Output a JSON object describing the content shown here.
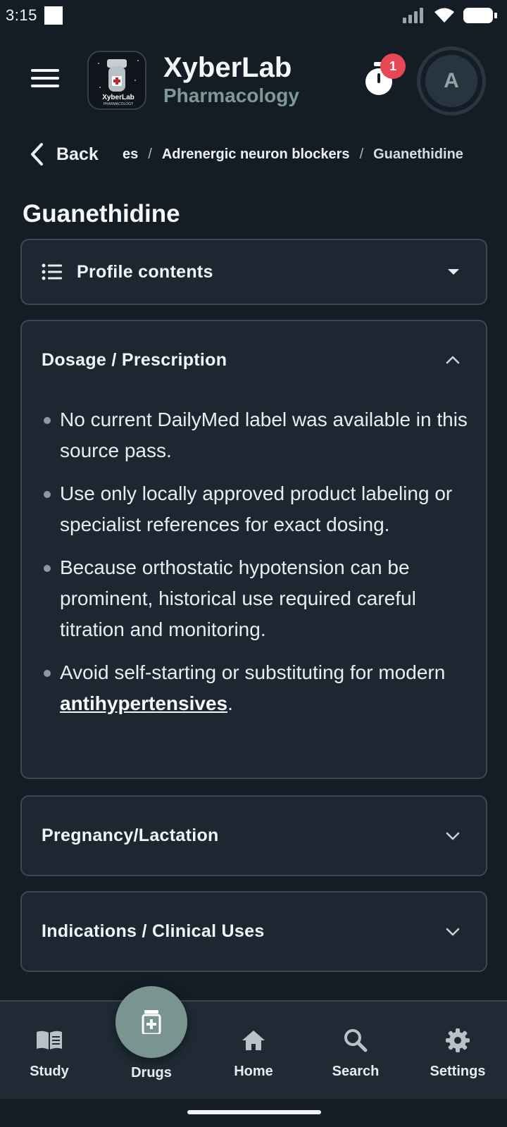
{
  "status_bar": {
    "time": "3:15"
  },
  "header": {
    "brand_title": "XyberLab",
    "brand_subtitle": "Pharmacology",
    "logo_text": "XyberLab",
    "logo_subtext": "PHARMACOLOGY",
    "timer_badge_count": "1",
    "avatar_initial": "A"
  },
  "breadcrumb": {
    "back_label": "Back",
    "items": [
      "es",
      "Adrenergic neuron blockers",
      "Guanethidine"
    ]
  },
  "page": {
    "title": "Guanethidine"
  },
  "sections": {
    "contents": {
      "label": "Profile contents"
    },
    "dosage": {
      "label": "Dosage / Prescription",
      "bullets": [
        "No current DailyMed label was available in this source pass.",
        "Use only locally approved product labeling or specialist references for exact dosing.",
        "Because orthostatic hypotension can be prominent, historical use required careful titration and monitoring."
      ],
      "last_bullet_prefix": "Avoid self-starting or substituting for modern ",
      "last_bullet_link": "antihypertensives",
      "last_bullet_suffix": "."
    },
    "pregnancy": {
      "label": "Pregnancy/Lactation"
    },
    "indications": {
      "label": "Indications / Clinical Uses"
    }
  },
  "bottom_nav": {
    "study": "Study",
    "drugs": "Drugs",
    "home": "Home",
    "search": "Search",
    "settings": "Settings"
  },
  "colors": {
    "background": "#141d26",
    "card": "#1c2732",
    "accent": "#7a958f",
    "badge": "#e84855"
  }
}
